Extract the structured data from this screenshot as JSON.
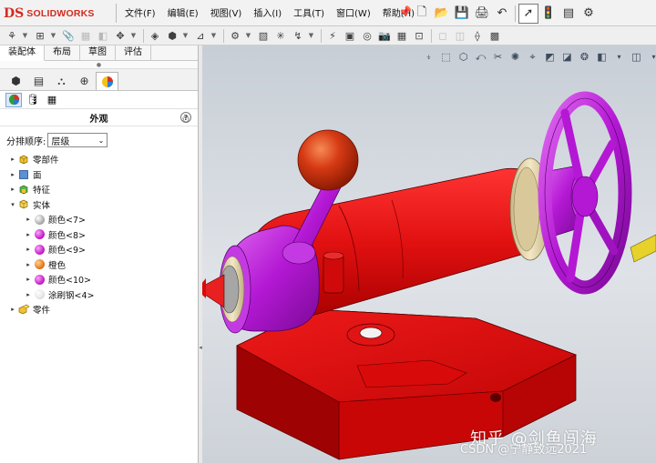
{
  "app": {
    "brand_mark": "DS",
    "brand_name": "SOLIDWORKS"
  },
  "menu": [
    "文件(F)",
    "编辑(E)",
    "视图(V)",
    "插入(I)",
    "工具(T)",
    "窗口(W)",
    "帮助(H)"
  ],
  "quick_access_icons": [
    "new-document-icon",
    "open-icon",
    "save-icon",
    "print-icon",
    "options-icon",
    "undo-icon",
    "select-pointer-icon",
    "rebuild-icon",
    "file-properties-icon",
    "options-gear-icon"
  ],
  "command_manager": {
    "tabs": [
      "装配体",
      "布局",
      "草图",
      "评估"
    ],
    "active": "装配体"
  },
  "manager_tabs": [
    "featuremanager-icon",
    "propertymanager-icon",
    "configurationmanager-icon",
    "dimxpert-icon",
    "displaymanager-icon"
  ],
  "display_subtabs": [
    "appearances-icon",
    "decals-icon",
    "scenes-icon"
  ],
  "panel": {
    "title": "外观",
    "sort_label": "分排顺序:",
    "sort_value": "层级",
    "tree": [
      {
        "label": "零部件",
        "level": 0,
        "toggle": "▸",
        "icon": "components-icon"
      },
      {
        "label": "面",
        "level": 0,
        "toggle": "▸",
        "icon": "face-icon"
      },
      {
        "label": "特征",
        "level": 0,
        "toggle": "▸",
        "icon": "feature-icon"
      },
      {
        "label": "实体",
        "level": 0,
        "toggle": "▾",
        "icon": "solid-body-icon"
      },
      {
        "label": "颜色<7>",
        "level": 1,
        "toggle": "▸",
        "color": "#b0b0b0"
      },
      {
        "label": "颜色<8>",
        "level": 1,
        "toggle": "▸",
        "color": "#cc22cc"
      },
      {
        "label": "颜色<9>",
        "level": 1,
        "toggle": "▸",
        "color": "#cc22cc"
      },
      {
        "label": "橙色",
        "level": 1,
        "toggle": "▸",
        "color": "#e87c1a"
      },
      {
        "label": "颜色<10>",
        "level": 1,
        "toggle": "▸",
        "color": "#cc22cc"
      },
      {
        "label": "涂刷钢<4>",
        "level": 1,
        "toggle": "▸",
        "color": "#dddddd"
      },
      {
        "label": "零件",
        "level": 0,
        "toggle": "▸",
        "icon": "part-icon"
      }
    ]
  },
  "overlay": {
    "watermark": "知乎 @剑鱼闯海",
    "credit": "CSDN @宁静致远2021"
  },
  "colors": {
    "body_red": "#e01010",
    "handwheel_magenta": "#b418d4",
    "knob_red": "#d63a14",
    "ring_cream": "#efe2bc"
  }
}
